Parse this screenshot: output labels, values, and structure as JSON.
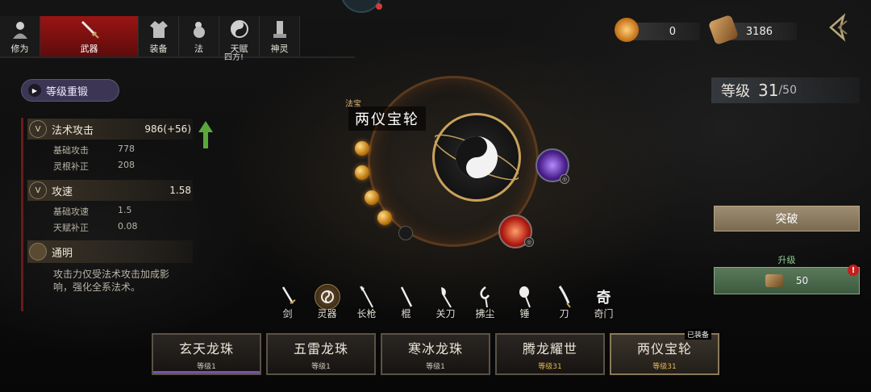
{
  "tabs": [
    {
      "id": "cultivation",
      "label": "修为",
      "icon": "bust-icon"
    },
    {
      "id": "weapon",
      "label": "武器",
      "icon": "sword-icon",
      "active": true
    },
    {
      "id": "equipment",
      "label": "装备",
      "icon": "robe-icon"
    },
    {
      "id": "treasure",
      "label": "法",
      "icon": "gourd-icon"
    },
    {
      "id": "talent",
      "label": "天赋",
      "icon": "yinyang-icon"
    },
    {
      "id": "spirit",
      "label": "神灵",
      "icon": "shrine-icon"
    }
  ],
  "tooltip_fragment": "四方!",
  "currency": {
    "coins": "0",
    "stones": "3186",
    "coin_color": "#e8a040",
    "stone_color": "#a0703a"
  },
  "level": {
    "label": "等级",
    "current": "31",
    "max": "/50"
  },
  "reset_button": "等级重锻",
  "stats": {
    "magic_attack": {
      "label": "法术攻击",
      "value": "986",
      "bonus": "(+56)",
      "base_label": "基础攻击",
      "base_value": "778",
      "root_label": "灵根补正",
      "root_value": "208"
    },
    "attack_speed": {
      "label": "攻速",
      "value": "1.58",
      "base_label": "基础攻速",
      "base_value": "1.5",
      "talent_label": "天赋补正",
      "talent_value": "0.08"
    },
    "trait": {
      "label": "通明",
      "description": "攻击力仅受法术攻击加成影响，强化全系法术。"
    }
  },
  "weapon": {
    "type": "法宝",
    "name": "两仪宝轮"
  },
  "weapon_types": [
    {
      "label": "剑",
      "icon": "sword-icon"
    },
    {
      "label": "灵器",
      "icon": "spirit-artifact-icon",
      "active": true
    },
    {
      "label": "长枪",
      "icon": "spear-icon"
    },
    {
      "label": "棍",
      "icon": "staff-icon"
    },
    {
      "label": "关刀",
      "icon": "guandao-icon"
    },
    {
      "label": "拂尘",
      "icon": "whisk-icon"
    },
    {
      "label": "锤",
      "icon": "hammer-icon"
    },
    {
      "label": "刀",
      "icon": "blade-icon"
    },
    {
      "label": "奇门",
      "icon": "qimen-icon"
    }
  ],
  "actions": {
    "breakthrough": "突破",
    "upgrade_label": "升级",
    "upgrade_cost": "50",
    "alert": "!"
  },
  "cards": [
    {
      "name": "玄天龙珠",
      "level": "等级1",
      "bar": true
    },
    {
      "name": "五雷龙珠",
      "level": "等级1"
    },
    {
      "name": "寒冰龙珠",
      "level": "等级1"
    },
    {
      "name": "腾龙耀世",
      "level": "等级31",
      "gold": true
    },
    {
      "name": "两仪宝轮",
      "level": "等级31",
      "gold": true,
      "equipped": true
    }
  ],
  "equipped_tag": "已装备"
}
